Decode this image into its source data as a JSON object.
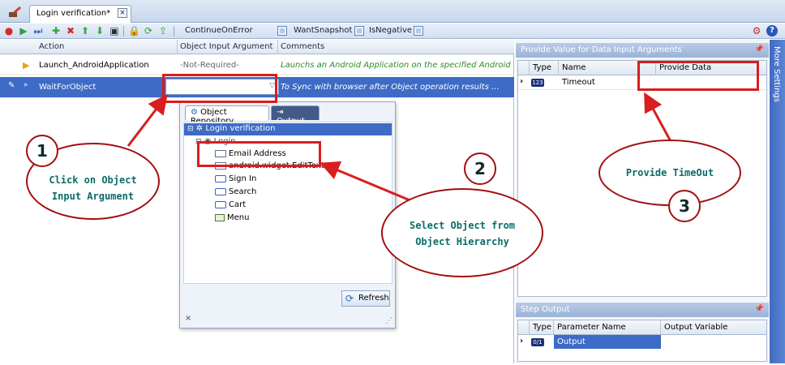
{
  "tab": {
    "title": "Login verification*",
    "close": "×"
  },
  "toolbar": {
    "continue_on_error": "ContinueOnError",
    "want_snapshot": "WantSnapshot",
    "is_negative": "IsNegative"
  },
  "grid": {
    "headers": [
      "Action",
      "Object Input Argument",
      "Comments"
    ],
    "rows": [
      {
        "action": "Launch_AndroidApplication",
        "argument": "-Not-Required-",
        "comment": "Launchs an Android Application on the specified Android Device"
      },
      {
        "action": "WaitForObject",
        "argument": "",
        "comment": "To Sync with browser after Object operation results ..."
      }
    ]
  },
  "popup": {
    "tabs": [
      "Object Repository",
      "Output"
    ],
    "tree": {
      "root": "Login verification",
      "login": "Login",
      "items": [
        "Email Address",
        "android.widget.EditText",
        "Sign In",
        "Search",
        "Cart",
        "Menu"
      ]
    },
    "refresh_label": "Refresh",
    "close": "×",
    "grip": "⋰"
  },
  "input_panel": {
    "title": "Provide Value for Data Input Arguments",
    "headers": [
      "Type",
      "Name",
      "Provide Data"
    ],
    "row": {
      "type": "123",
      "name": "Timeout",
      "value": ""
    }
  },
  "step_output": {
    "title": "Step Output",
    "headers": [
      "Type",
      "Parameter Name",
      "Output Variable"
    ],
    "row": {
      "type": "0/1",
      "name": "Output",
      "variable": ""
    }
  },
  "side_tab": "More Settings",
  "annotations": {
    "step1": {
      "number": "1",
      "line1": "Click on Object",
      "line2": "Input Argument"
    },
    "step2": {
      "number": "2",
      "line1": "Select Object from",
      "line2": "Object Hierarchy"
    },
    "step3": {
      "number": "3",
      "line1": "Provide TimeOut"
    }
  },
  "colors": {
    "selection": "#3d6bc6",
    "annotation_red": "#d81e1e",
    "annotation_text": "#0a6c6a"
  }
}
